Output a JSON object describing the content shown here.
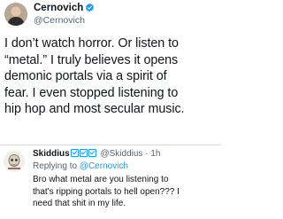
{
  "tweet": {
    "display_name": "Cernovich",
    "handle": "@Cernovich",
    "body_lines": [
      "I don’t watch horror. Or listen to",
      "“metal.” I truly believes it opens",
      "demonic portals via a spirit of",
      "fear. I even stopped listening to",
      "hip hop and most secular music."
    ],
    "icons": {
      "verified": "verified-badge-icon",
      "avatar": "profile-avatar"
    }
  },
  "reply": {
    "display_name": "Skiddius",
    "handle": "@Skiddius",
    "separator": "·",
    "time": "1h",
    "replying_prefix": "Replying to",
    "replying_to": "@Cernovich",
    "body_lines": [
      "Bro what metal are you listening to",
      "that's ripping portals to hell open??? I",
      "need that shit in my life."
    ],
    "icons": {
      "badges": "check-box-icon",
      "avatar": "skull-avatar"
    }
  },
  "colors": {
    "accent": "#1d9bf0",
    "text": "#0f1419",
    "secondary": "#536471",
    "divider": "#cfd9de"
  }
}
